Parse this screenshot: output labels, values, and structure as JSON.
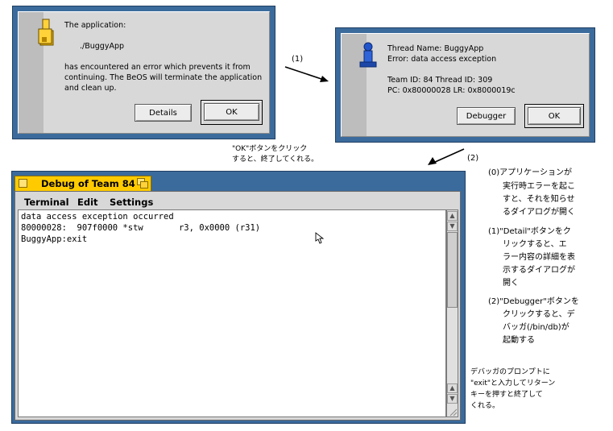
{
  "alert1": {
    "line1": "The application:",
    "line2": "./BuggyApp",
    "line3": "has encountered an error which prevents it from",
    "line4": "continuing. The BeOS will terminate the application",
    "line5": "and clean up.",
    "details_label": "Details",
    "ok_label": "OK"
  },
  "alert2": {
    "line1": "Thread Name: BuggyApp",
    "line2": "Error: data access exception",
    "line3": "Team ID: 84 Thread ID: 309",
    "line4": "PC: 0x80000028 LR: 0x8000019c",
    "debugger_label": "Debugger",
    "ok_label": "OK"
  },
  "annotations": {
    "step1": "(1)",
    "step2": "(2)",
    "ok_note_line1": "\"OK\"ボタンをクリック",
    "ok_note_line2": "すると、終了してくれる。",
    "n0_l1": "(0)アプリケーションが",
    "n0_l2": "実行時エラーを起こ",
    "n0_l3": "すと、それを知らせ",
    "n0_l4": "るダイアログが開く",
    "n1_l1": "(1)\"Detail\"ボタンをク",
    "n1_l2": "リックすると、エ",
    "n1_l3": "ラー内容の詳細を表",
    "n1_l4": "示するダイアログが",
    "n1_l5": "開く",
    "n2_l1": "(2)\"Debugger\"ボタンを",
    "n2_l2": "クリックすると、デ",
    "n2_l3": "バッガ(/bin/db)が",
    "n2_l4": "起動する",
    "exit_l1": "デバッガのプロンプトに",
    "exit_l2": "\"exit\"と入力してリターン",
    "exit_l3": "キーを押すと終了して",
    "exit_l4": "くれる。"
  },
  "terminal": {
    "title": "Debug of Team 84",
    "menu": [
      "Terminal",
      "Edit",
      "Settings"
    ],
    "lines": [
      "data access exception occurred",
      "80000028:  907f0000 *stw       r3, 0x0000 (r31)",
      "BuggyApp:exit"
    ]
  },
  "colors": {
    "window_frame": "#3b6b9c",
    "tab_yellow": "#ffcb00",
    "panel_gray": "#d8d8d8"
  },
  "icons": [
    "app-warning-icon",
    "debugger-figure-icon",
    "close-box-icon",
    "zoom-box-icon",
    "text-cursor-icon"
  ]
}
